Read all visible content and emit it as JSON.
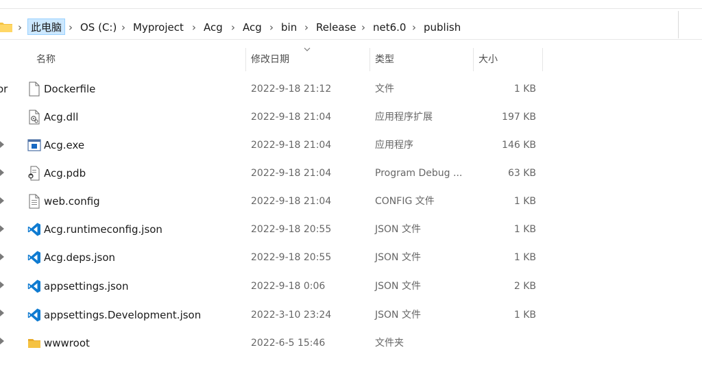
{
  "breadcrumb": {
    "root": "此电脑",
    "items": [
      "OS (C:)",
      "Myproject",
      "Acg",
      "Acg",
      "bin",
      "Release",
      "net6.0",
      "publish"
    ],
    "separator": "›"
  },
  "nav_pane": {
    "partial_label": "or"
  },
  "columns": {
    "name": "名称",
    "modified": "修改日期",
    "type": "类型",
    "size": "大小",
    "sorted_by": "修改日期",
    "sort_direction": "descending"
  },
  "files": [
    {
      "name": "Dockerfile",
      "modified": "2022-9-18 21:12",
      "type": "文件",
      "size": "1 KB",
      "icon": "blank-file-icon"
    },
    {
      "name": "Acg.dll",
      "modified": "2022-9-18 21:04",
      "type": "应用程序扩展",
      "size": "197 KB",
      "icon": "dll-file-icon"
    },
    {
      "name": "Acg.exe",
      "modified": "2022-9-18 21:04",
      "type": "应用程序",
      "size": "146 KB",
      "icon": "exe-file-icon"
    },
    {
      "name": "Acg.pdb",
      "modified": "2022-9-18 21:04",
      "type": "Program Debug ...",
      "size": "63 KB",
      "icon": "pdb-file-icon"
    },
    {
      "name": "web.config",
      "modified": "2022-9-18 21:04",
      "type": "CONFIG 文件",
      "size": "1 KB",
      "icon": "config-file-icon"
    },
    {
      "name": "Acg.runtimeconfig.json",
      "modified": "2022-9-18 20:55",
      "type": "JSON 文件",
      "size": "1 KB",
      "icon": "vscode-json-icon"
    },
    {
      "name": "Acg.deps.json",
      "modified": "2022-9-18 20:55",
      "type": "JSON 文件",
      "size": "1 KB",
      "icon": "vscode-json-icon"
    },
    {
      "name": "appsettings.json",
      "modified": "2022-9-18 0:06",
      "type": "JSON 文件",
      "size": "2 KB",
      "icon": "vscode-json-icon"
    },
    {
      "name": "appsettings.Development.json",
      "modified": "2022-3-10 23:24",
      "type": "JSON 文件",
      "size": "1 KB",
      "icon": "vscode-json-icon"
    },
    {
      "name": "wwwroot",
      "modified": "2022-6-5 15:46",
      "type": "文件夹",
      "size": "",
      "icon": "folder-icon"
    }
  ],
  "colors": {
    "breadcrumb_highlight": "#cce8ff",
    "vscode_blue": "#0f7bd1",
    "folder_yellow": "#f5c242"
  }
}
